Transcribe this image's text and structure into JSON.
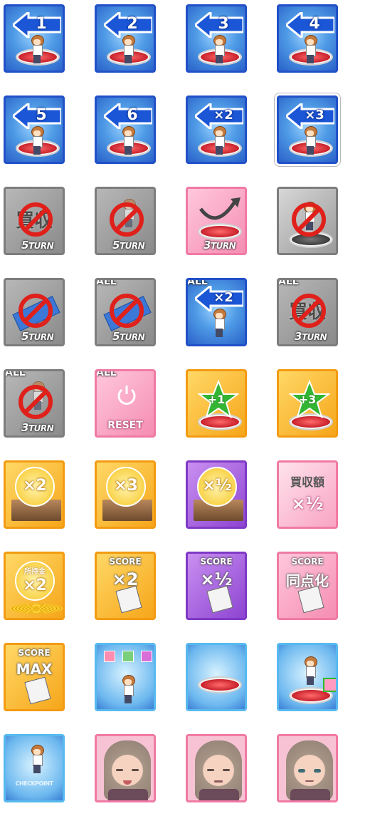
{
  "row1": [
    {
      "number": "1"
    },
    {
      "number": "2"
    },
    {
      "number": "3"
    },
    {
      "number": "4"
    }
  ],
  "row2": [
    {
      "number": "5"
    },
    {
      "number": "6"
    },
    {
      "number": "×2"
    },
    {
      "number": "×3"
    }
  ],
  "labels": {
    "turn5": "TURN",
    "turn_num_5": "5",
    "turn_num_3": "3",
    "all": "ALL",
    "buyout": "買収",
    "reset": "RESET",
    "plus1": "+1",
    "plus3": "+3",
    "x2": "×2",
    "x3": "×3",
    "half": "×½",
    "buyout_amount": "買収額",
    "buyout_amount_half": "×½",
    "money": "所持金",
    "money_x2": "×2",
    "score": "SCORE",
    "score_x2": "×2",
    "score_half": "×½",
    "score_equal": "同点化",
    "score_max": "MAX",
    "checkpoint": "CHECKPOINT"
  },
  "colors": {
    "blue": "#2250c8",
    "gray": "#7d7d7d",
    "pink": "#f07aa4",
    "orange": "#f39b12",
    "purple": "#7f39c6"
  },
  "icons": [
    "back-arrow-icon",
    "ban-icon",
    "curve-arrow-icon",
    "power-icon",
    "star-icon",
    "coin-icon",
    "paper-pen-icon"
  ]
}
